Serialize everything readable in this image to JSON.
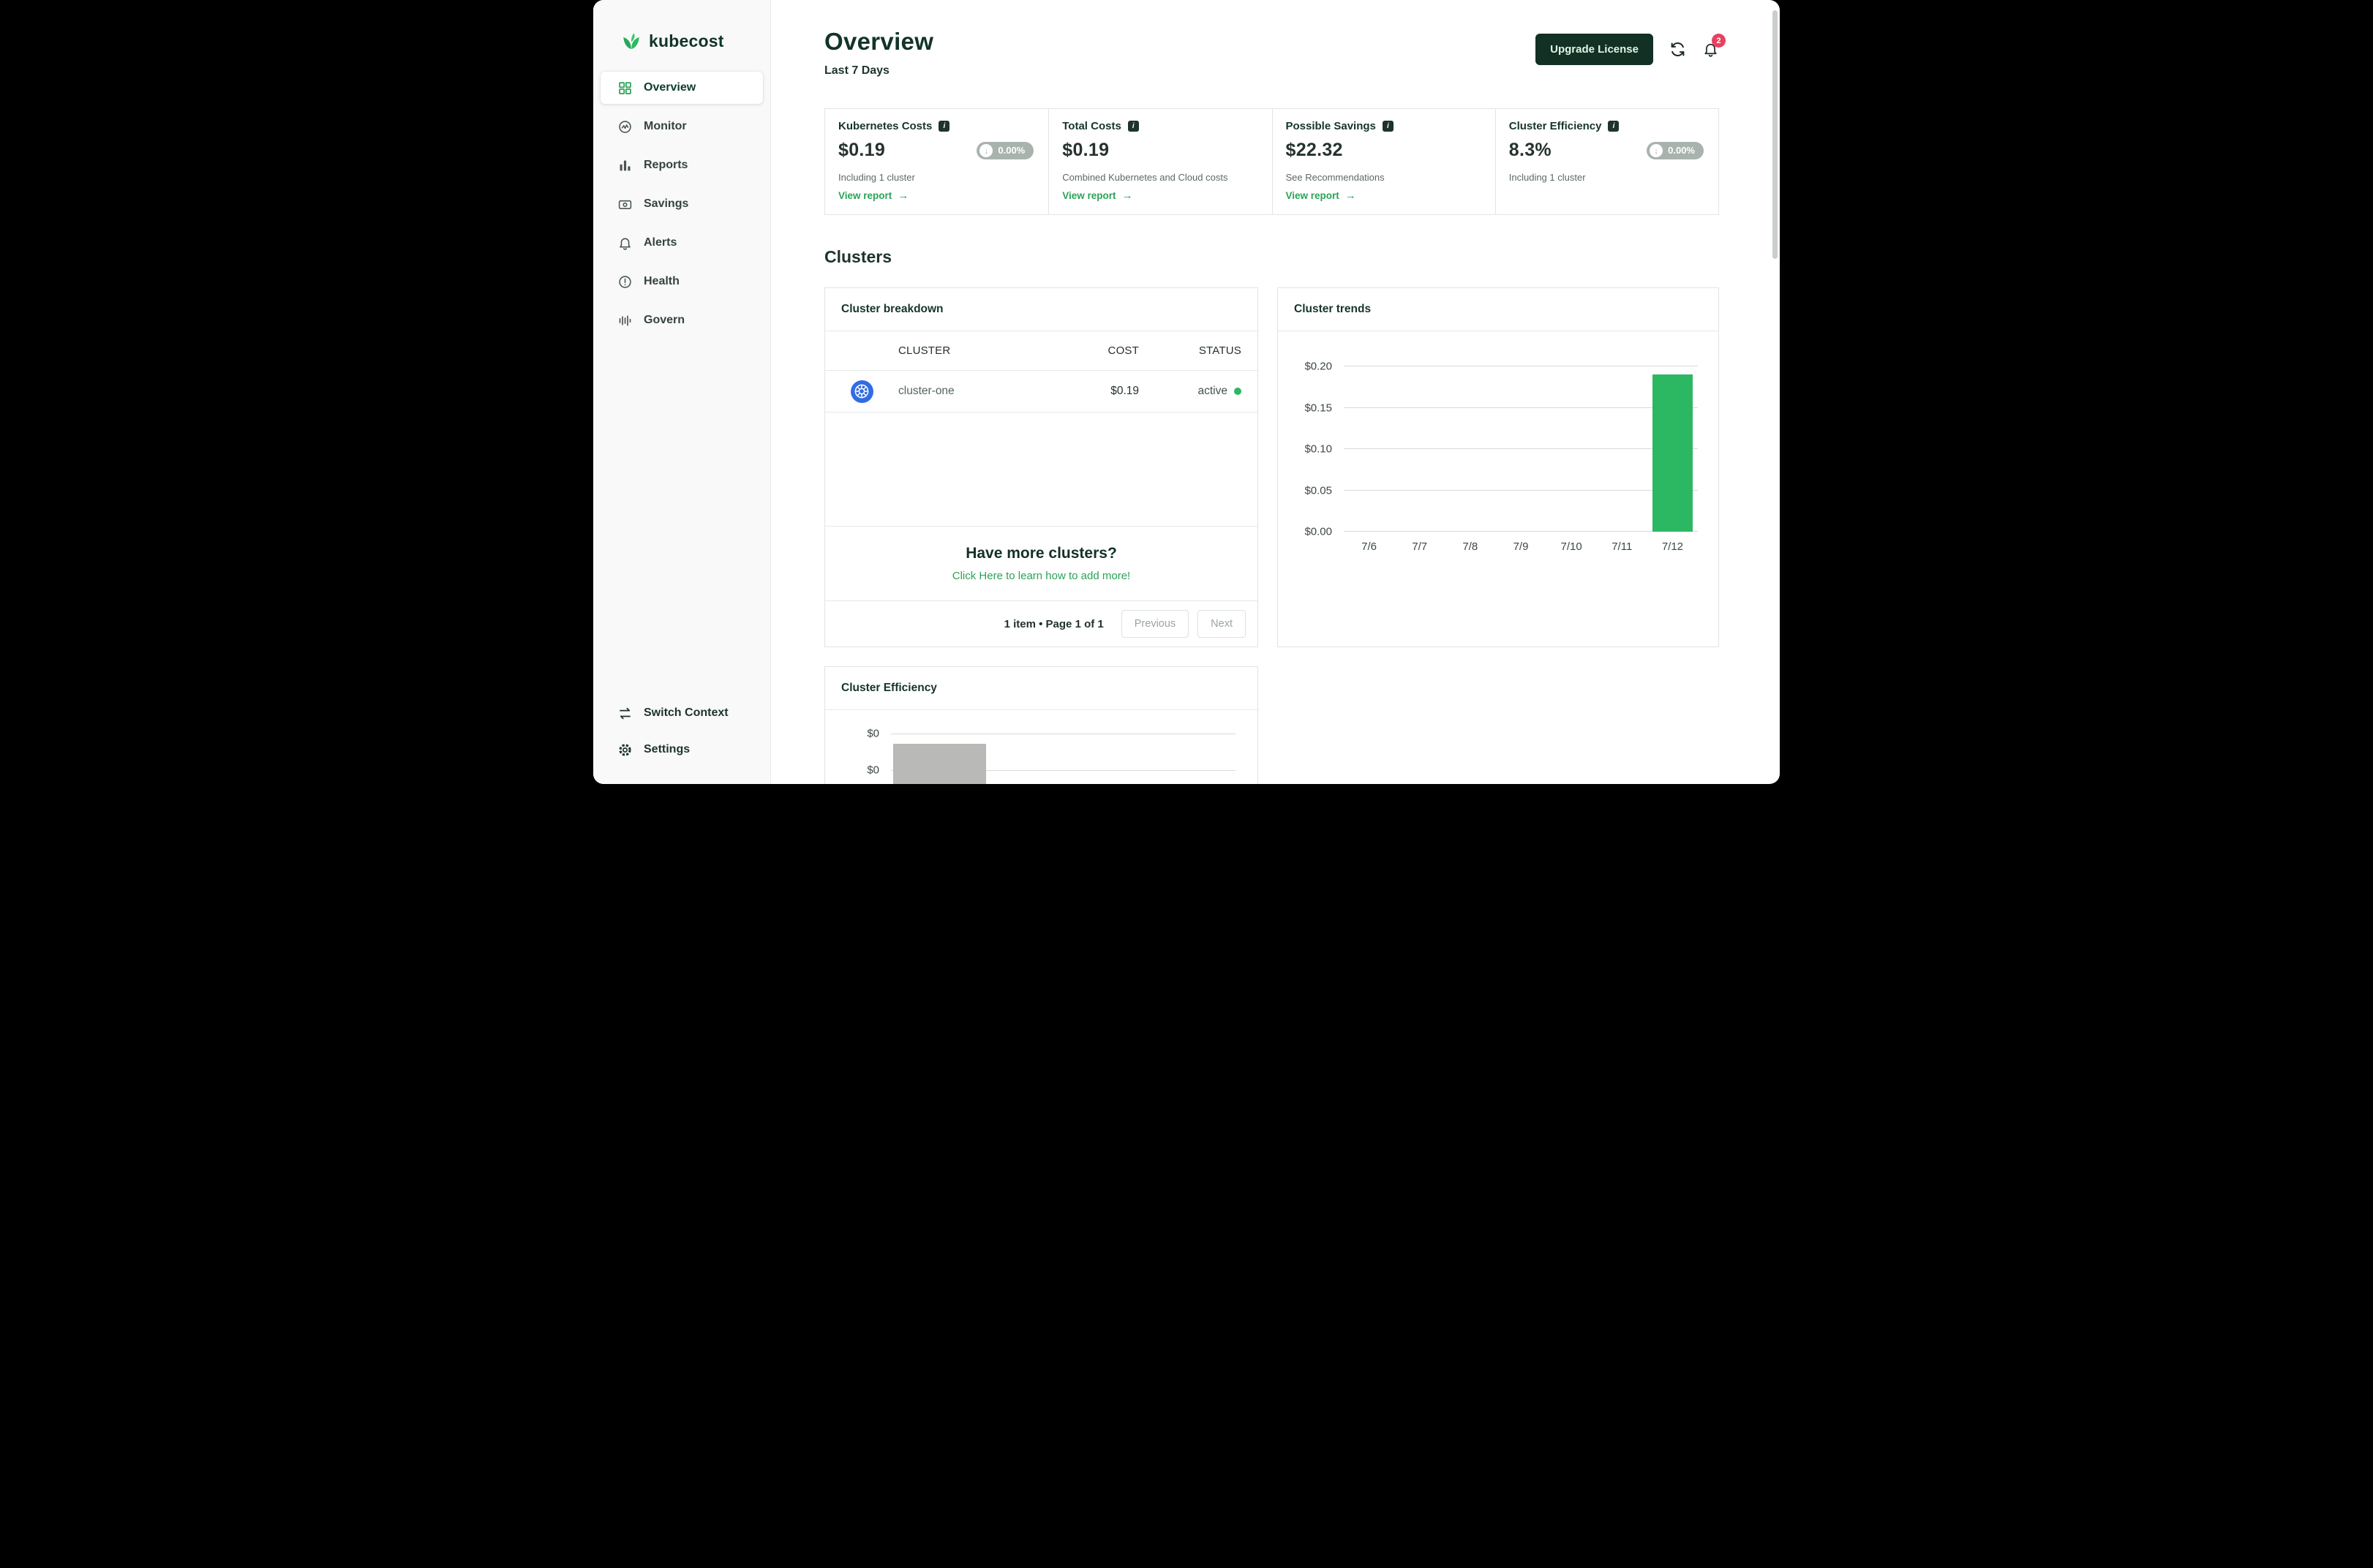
{
  "sidebar": {
    "brand": "kubecost",
    "items": [
      {
        "label": "Overview",
        "icon": "grid-icon",
        "active": true
      },
      {
        "label": "Monitor",
        "icon": "monitor-wave-icon",
        "active": false
      },
      {
        "label": "Reports",
        "icon": "bar-chart-icon",
        "active": false
      },
      {
        "label": "Savings",
        "icon": "cash-icon",
        "active": false
      },
      {
        "label": "Alerts",
        "icon": "bell-icon",
        "active": false
      },
      {
        "label": "Health",
        "icon": "alert-circle-icon",
        "active": false
      },
      {
        "label": "Govern",
        "icon": "waves-icon",
        "active": false
      }
    ],
    "switch_context": "Switch Context",
    "settings": "Settings"
  },
  "header": {
    "title": "Overview",
    "subtitle": "Last 7 Days",
    "upgrade_button": "Upgrade License",
    "notifications": "2"
  },
  "stats": {
    "cards": [
      {
        "title": "Kubernetes Costs",
        "value": "$0.19",
        "delta": "0.00%",
        "note": "Including 1 cluster",
        "link": "View report"
      },
      {
        "title": "Total Costs",
        "value": "$0.19",
        "note": "Combined Kubernetes and Cloud costs",
        "link": "View report"
      },
      {
        "title": "Possible Savings",
        "value": "$22.32",
        "note": "See Recommendations",
        "link": "View report"
      },
      {
        "title": "Cluster Efficiency",
        "value": "8.3%",
        "delta": "0.00%",
        "note": "Including 1 cluster"
      }
    ]
  },
  "clusters": {
    "heading": "Clusters"
  },
  "breakdown": {
    "title": "Cluster breakdown",
    "columns": {
      "cluster": "CLUSTER",
      "cost": "COST",
      "status": "STATUS"
    },
    "rows": [
      {
        "cluster": "cluster-one",
        "cost": "$0.19",
        "status": "active"
      }
    ],
    "more_heading": "Have more clusters?",
    "more_link": "Click Here to learn how to add more!",
    "pagination": {
      "summary": "1 item • Page 1 of 1",
      "prev": "Previous",
      "next": "Next"
    }
  },
  "chart_data": [
    {
      "type": "bar",
      "title": "Cluster trends",
      "categories": [
        "7/6",
        "7/7",
        "7/8",
        "7/9",
        "7/10",
        "7/11",
        "7/12"
      ],
      "values": [
        0,
        0,
        0,
        0,
        0,
        0,
        0.19
      ],
      "ylim": [
        0,
        0.2
      ],
      "ytick_labels": [
        "$0.00",
        "$0.05",
        "$0.10",
        "$0.15",
        "$0.20"
      ],
      "bar_color": "#2cb862",
      "grid": true,
      "legend": "none"
    },
    {
      "type": "bar",
      "title": "Cluster Efficiency",
      "ytick_labels": [
        "$0",
        "$0"
      ],
      "bar_color": "#b9bab8"
    }
  ],
  "colors": {
    "accent_green": "#2cb862",
    "link_green": "#2aa356",
    "dark_green": "#123429",
    "badge_red": "#e8415f",
    "kubernetes_blue": "#326ce5",
    "delta_pill_gray": "#a9b3ae"
  }
}
